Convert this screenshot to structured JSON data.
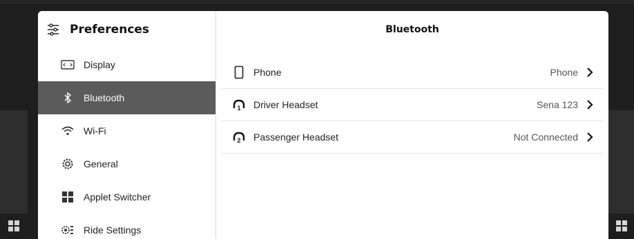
{
  "preferences": {
    "title": "Preferences",
    "nav": [
      {
        "label": "Display",
        "icon": "display-icon"
      },
      {
        "label": "Bluetooth",
        "icon": "bluetooth-icon",
        "active": true
      },
      {
        "label": "Wi-Fi",
        "icon": "wifi-icon"
      },
      {
        "label": "General",
        "icon": "general-gear-icon"
      },
      {
        "label": "Applet Switcher",
        "icon": "applet-switcher-icon"
      },
      {
        "label": "Ride Settings",
        "icon": "ride-settings-icon"
      }
    ]
  },
  "bluetooth": {
    "title": "Bluetooth",
    "devices": [
      {
        "name": "Phone",
        "status": "Phone",
        "icon": "phone-icon"
      },
      {
        "name": "Driver Headset",
        "status": "Sena 123",
        "icon": "headset-1-icon"
      },
      {
        "name": "Passenger Headset",
        "status": "Not Connected",
        "icon": "headset-2-icon"
      }
    ]
  },
  "colors": {
    "active_bg": "#5b5b5b",
    "background": "#1e1e1e"
  }
}
